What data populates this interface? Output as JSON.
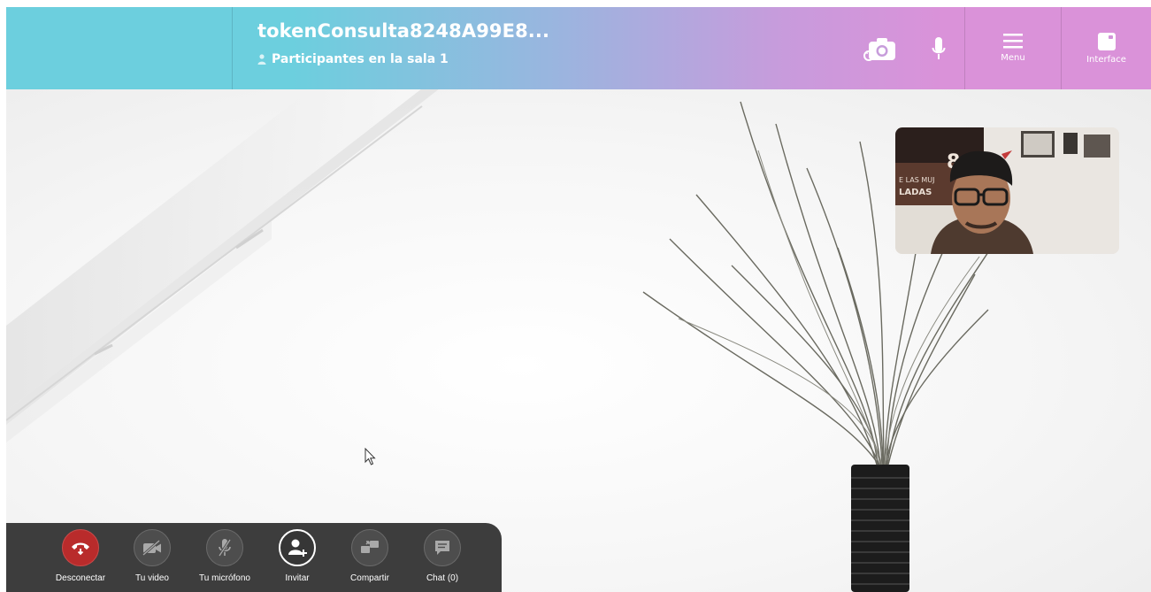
{
  "header": {
    "room_title": "tokenConsulta8248A99E8...",
    "participants_label": "Participantes en la sala 1",
    "buttons": {
      "switch_camera_icon": "camera-switch-icon",
      "microphone_icon": "microphone-icon",
      "menu_label": "Menu",
      "interface_label": "Interface"
    }
  },
  "controls": {
    "disconnect_label": "Desconectar",
    "video_label": "Tu video",
    "microphone_label": "Tu micrófono",
    "invite_label": "Invitar",
    "share_label": "Compartir",
    "chat_label": "Chat (0)"
  },
  "colors": {
    "header_start": "#6ccfde",
    "header_end": "#da92d9",
    "dock_background": "#3d3d3d",
    "disconnect_red": "#b92b2b"
  }
}
